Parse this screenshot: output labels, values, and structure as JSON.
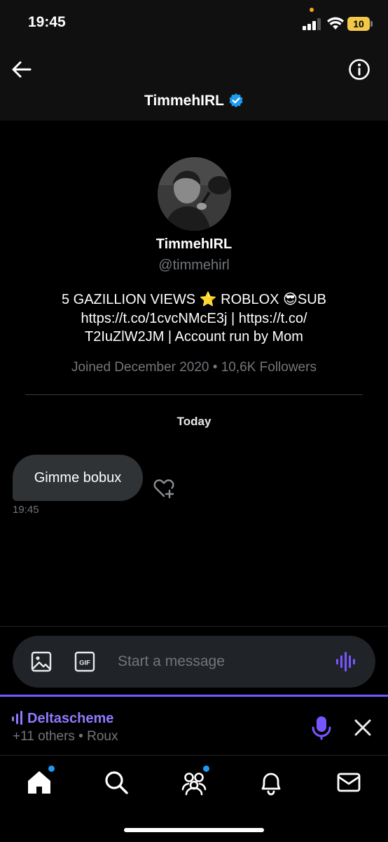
{
  "status_bar": {
    "time": "19:45",
    "battery_level": "10",
    "battery_color": "#f3c84a"
  },
  "header": {
    "title": "TimmehIRL",
    "back_icon": "arrow-left-icon",
    "info_icon": "info-icon",
    "verified_icon": "verified-badge-icon",
    "verified_color": "#1d9bf0"
  },
  "profile": {
    "name": "TimmehIRL",
    "handle": "@timmehirl",
    "bio_lines": [
      "5 GAZILLION VIEWS ⭐ ROBLOX 😎SUB",
      "https://t.co/1cvcNMcE3j | https://t.co/",
      "T2IuZlW2JM | Account run by Mom"
    ],
    "joined": "Joined December 2020 • 10,6K Followers"
  },
  "conversation": {
    "day_label": "Today",
    "messages": [
      {
        "text": "Gimme bobux",
        "time": "19:45"
      }
    ]
  },
  "compose": {
    "placeholder": "Start a message",
    "image_icon": "image-icon",
    "gif_icon": "gif-icon",
    "voice_icon": "voice-wave-icon"
  },
  "space": {
    "name": "Deltascheme",
    "subtitle": "+11 others • Roux",
    "accent": "#7856ff",
    "mic_icon": "microphone-icon",
    "close_icon": "close-icon"
  },
  "tabbar": {
    "items": [
      {
        "icon": "home-icon",
        "badge": true
      },
      {
        "icon": "search-icon",
        "badge": false
      },
      {
        "icon": "communities-icon",
        "badge": true
      },
      {
        "icon": "bell-icon",
        "badge": false
      },
      {
        "icon": "mail-icon",
        "badge": false
      }
    ],
    "badge_color": "#1d9bf0"
  },
  "colors": {
    "background": "#000000",
    "secondary_text": "#71767b",
    "bubble": "#2f3336"
  }
}
